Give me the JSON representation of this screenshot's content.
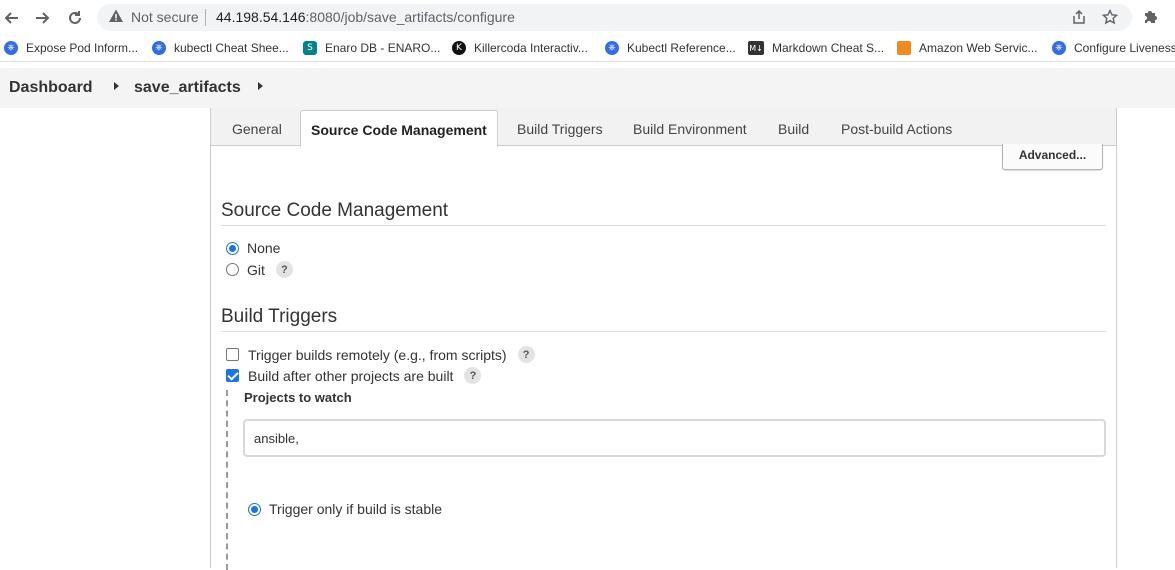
{
  "browser": {
    "not_secure": "Not secure",
    "url_host": "44.198.54.146",
    "url_rest": ":8080/job/save_artifacts/configure"
  },
  "bookmarks": [
    {
      "label": "Expose Pod Inform...",
      "icon": "kubernetes-icon",
      "color": "#326ce5"
    },
    {
      "label": "kubectl Cheat Shee...",
      "icon": "kubernetes-icon",
      "color": "#326ce5"
    },
    {
      "label": "Enaro DB - ENARO...",
      "icon": "sharepoint-icon",
      "color": "#038387"
    },
    {
      "label": "Killercoda Interactiv...",
      "icon": "killercoda-icon",
      "color": "#111111"
    },
    {
      "label": "Kubectl Reference...",
      "icon": "kubernetes-icon",
      "color": "#326ce5"
    },
    {
      "label": "Markdown Cheat S...",
      "icon": "markdown-icon",
      "color": "#333333"
    },
    {
      "label": "Amazon Web Servic...",
      "icon": "aws-icon",
      "color": "#f08a24"
    },
    {
      "label": "Configure Liveness...",
      "icon": "kubernetes-icon",
      "color": "#326ce5"
    }
  ],
  "breadcrumb": {
    "dashboard": "Dashboard",
    "job": "save_artifacts"
  },
  "tabs": [
    "General",
    "Source Code Management",
    "Build Triggers",
    "Build Environment",
    "Build",
    "Post-build Actions"
  ],
  "advanced_button": "Advanced...",
  "scm": {
    "title": "Source Code Management",
    "options": [
      "None",
      "Git"
    ],
    "selected": "None"
  },
  "triggers": {
    "title": "Build Triggers",
    "remote": "Trigger builds remotely (e.g., from scripts)",
    "after_other": "Build after other projects are built",
    "projects_label": "Projects to watch",
    "projects_value": "ansible,",
    "stable_option": "Trigger only if build is stable"
  },
  "help_glyph": "?",
  "accent_color": "#1a73e8"
}
